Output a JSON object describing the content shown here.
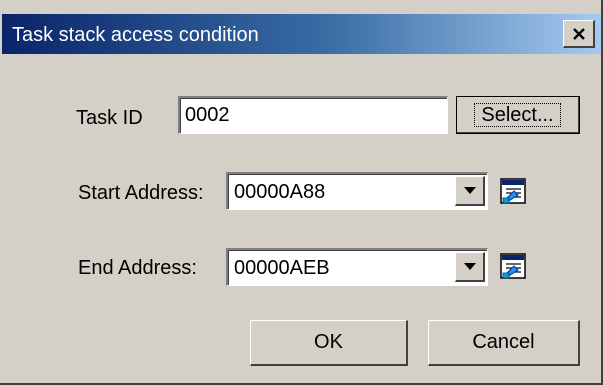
{
  "dialog": {
    "title": "Task stack access condition",
    "close_label": "×"
  },
  "task": {
    "label": "Task ID",
    "value": "0002",
    "select_label": "Select..."
  },
  "start": {
    "label": "Start Address:",
    "value": "00000A88"
  },
  "end": {
    "label": "End Address:",
    "value": "00000AEB"
  },
  "buttons": {
    "ok": "OK",
    "cancel": "Cancel"
  },
  "icons": {
    "dropdown": "dropdown-arrow-icon",
    "address_picker": "address-picker-icon",
    "close": "close-icon"
  }
}
